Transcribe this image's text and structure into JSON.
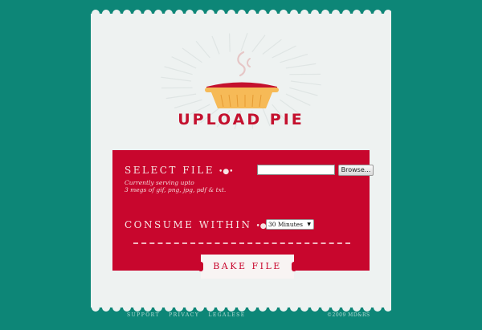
{
  "title": "UPLOAD PIE",
  "form": {
    "select_file_label": "SELECT FILE",
    "select_file_dots": "•●•",
    "note_line1": "Currently serving upto",
    "note_line2": "3 megs of gif, png, jpg, pdf & txt.",
    "browse_label": "Browse...",
    "consume_label": "CONSUME WITHIN",
    "consume_dots": "•●•",
    "consume_value": "30 Minutes",
    "bake_label": "BAKE FILE"
  },
  "footer": {
    "links": [
      "SUPPORT",
      "PRIVACY",
      "LEGALESE"
    ],
    "copyright": "©2009 MD&RS"
  },
  "colors": {
    "background": "#0d8677",
    "paper": "#eef2f1",
    "accent_red": "#c8062d",
    "pie_crust": "#f6ba57"
  }
}
